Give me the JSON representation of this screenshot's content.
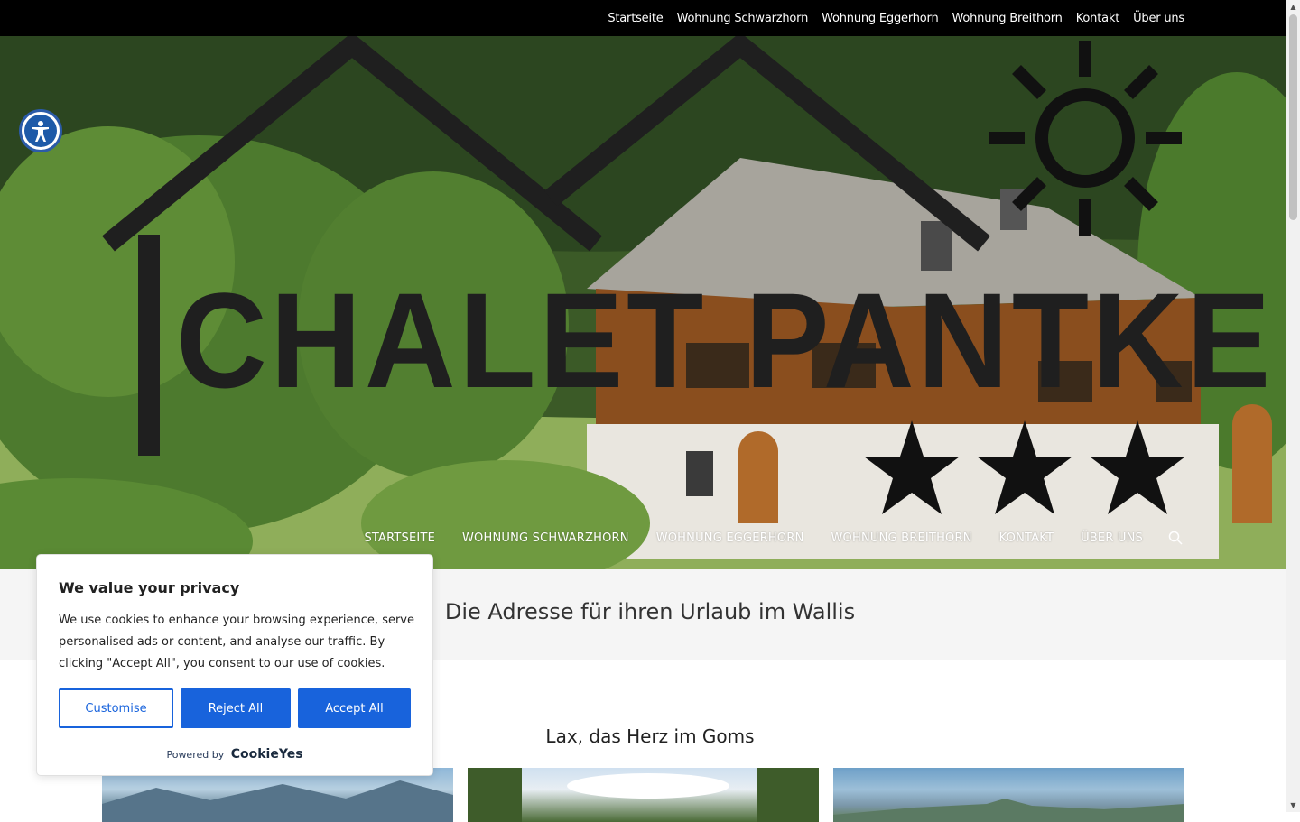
{
  "topnav": {
    "items": [
      "Startseite",
      "Wohnung Schwarzhorn",
      "Wohnung Eggerhorn",
      "Wohnung Breithorn",
      "Kontakt",
      "Über uns"
    ]
  },
  "hero": {
    "logo_text": "CHALET PANTKE",
    "stars": 3
  },
  "mainnav": {
    "items": [
      "STARTSEITE",
      "WOHNUNG SCHWARZHORN",
      "WOHNUNG EGGERHORN",
      "WOHNUNG BREITHORN",
      "KONTAKT",
      "ÜBER UNS"
    ],
    "search_icon": "search-icon"
  },
  "tagline": "Die Adresse für ihren Urlaub im Wallis",
  "section": {
    "title": "Lax, das Herz im Goms"
  },
  "cookie": {
    "title": "We value your privacy",
    "text": "We use cookies to enhance your browsing experience, serve personalised ads or content, and analyse our traffic. By clicking \"Accept All\", you consent to our use of cookies.",
    "customise_label": "Customise",
    "reject_label": "Reject All",
    "accept_label": "Accept All",
    "powered_by": "Powered by",
    "brand": "CookieYes"
  },
  "colors": {
    "accent": "#1863dc",
    "topbar": "#000000"
  }
}
